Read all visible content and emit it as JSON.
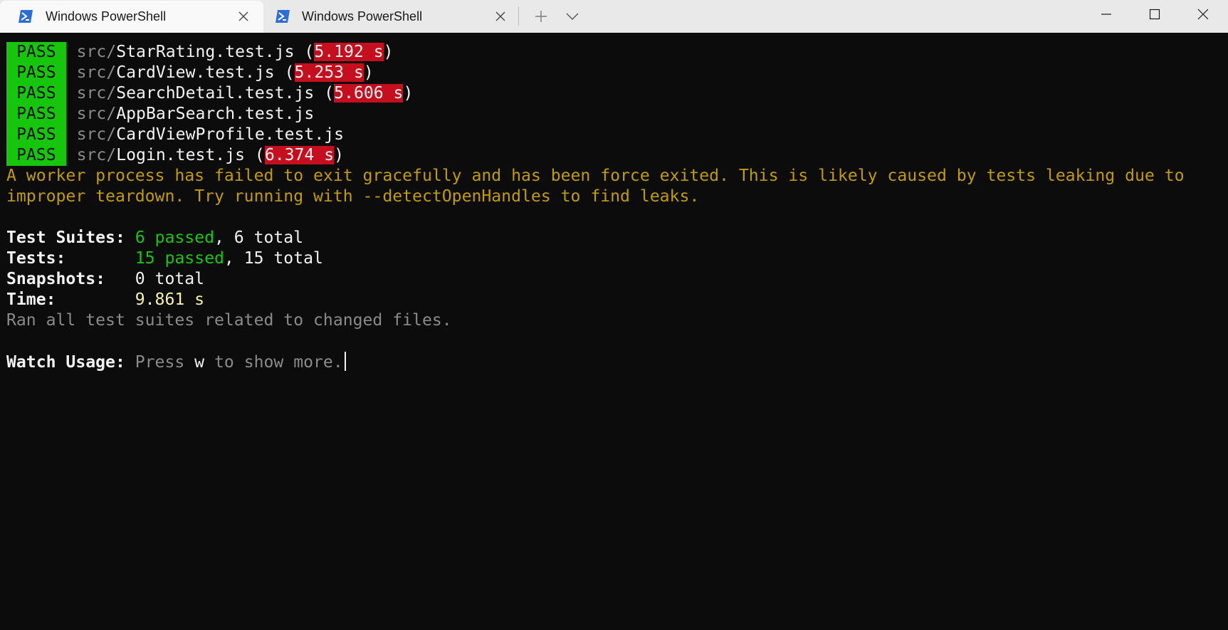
{
  "tabs": [
    {
      "title": "Windows PowerShell",
      "icon": "powershell-icon",
      "active": true
    },
    {
      "title": "Windows PowerShell",
      "icon": "powershell-icon",
      "active": false
    }
  ],
  "colors": {
    "pass_bg": "#16c60c",
    "time_bg": "#c50f1f",
    "warning": "#c19c00",
    "passed_text": "#16c60c",
    "time_text": "#f9f1a5",
    "background": "#0c0c0c"
  },
  "terminal": {
    "results": [
      {
        "status": "PASS",
        "dir": "src/",
        "file": "StarRating.test.js",
        "open": " (",
        "time": "5.192 s",
        "close": ")"
      },
      {
        "status": "PASS",
        "dir": "src/",
        "file": "CardView.test.js",
        "open": " (",
        "time": "5.253 s",
        "close": ")"
      },
      {
        "status": "PASS",
        "dir": "src/",
        "file": "SearchDetail.test.js",
        "open": " (",
        "time": "5.606 s",
        "close": ")"
      },
      {
        "status": "PASS",
        "dir": "src/",
        "file": "AppBarSearch.test.js"
      },
      {
        "status": "PASS",
        "dir": "src/",
        "file": "CardViewProfile.test.js"
      },
      {
        "status": "PASS",
        "dir": "src/",
        "file": "Login.test.js",
        "open": " (",
        "time": "6.374 s",
        "close": ")"
      }
    ],
    "warning_lines": [
      "A worker process has failed to exit gracefully and has been force exited. This is likely caused by tests leaking due to",
      "improper teardown. Try running with --detectOpenHandles to find leaks."
    ],
    "summary": {
      "suites": {
        "label": "Test Suites: ",
        "passed": "6 passed",
        "rest": ", 6 total"
      },
      "tests": {
        "label": "Tests:       ",
        "passed": "15 passed",
        "rest": ", 15 total"
      },
      "snapshots": {
        "label": "Snapshots:   ",
        "value": "0 total"
      },
      "time": {
        "label": "Time:        ",
        "value": "9.861 s"
      }
    },
    "ran_line": "Ran all test suites related to changed files.",
    "watch": {
      "label": "Watch Usage: ",
      "press": "Press ",
      "key": "w",
      "rest": " to show more."
    }
  }
}
